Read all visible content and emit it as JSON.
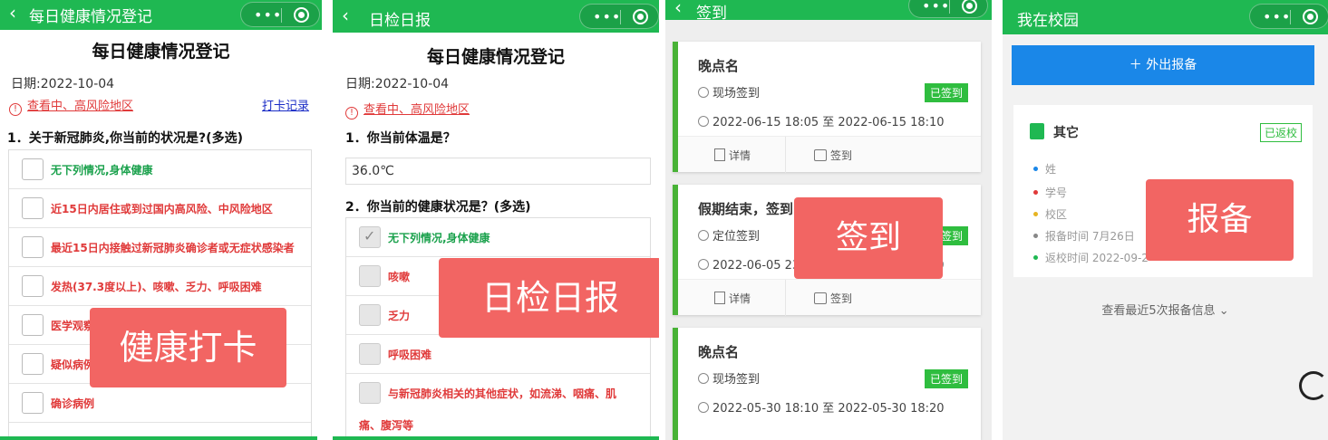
{
  "colors": {
    "nav_green": "#1fb852",
    "risk_red": "#e03a3a",
    "overlay_red": "#f26563",
    "blue_button": "#1a87e8",
    "signed_green": "#2fbd3f"
  },
  "panel1": {
    "nav_title": "每日健康情况登记",
    "form_title": "每日健康情况登记",
    "date": "日期:2022-10-04",
    "risk_link": "查看中、高风险地区",
    "record_link": "打卡记录",
    "question": "1．关于新冠肺炎,你当前的状况是?(多选)",
    "options": [
      "无下列情况,身体健康",
      "近15日内居住或到过国内高风险、中风险地区",
      "最近15日内接触过新冠肺炎确诊者或无症状感染者",
      "发热(37.3度以上)、咳嗽、乏力、呼吸困难",
      "医学观察",
      "疑似病例",
      "确诊病例"
    ],
    "overlay": "健康打卡"
  },
  "panel2": {
    "nav_title": "日检日报",
    "form_title": "每日健康情况登记",
    "date": "日期:2022-10-04",
    "risk_link": "查看中、高风险地区",
    "q1": "1．你当前体温是？",
    "temperature": "36.0℃",
    "q2": "2．你当前的健康状况是？(多选)",
    "options": [
      "无下列情况,身体健康",
      "咳嗽",
      "乏力",
      "呼吸困难",
      "与新冠肺炎相关的其他症状，如流涕、咽痛、肌",
      "痛、腹泻等"
    ],
    "overlay": "日检日报"
  },
  "panel3": {
    "nav_title": "签到",
    "cards": [
      {
        "title": "晚点名",
        "type": "现场签到",
        "status": "已签到",
        "time": "2022-06-15 18:05 至 2022-06-15 18:10",
        "detail": "详情",
        "sign": "签到"
      },
      {
        "title": "假期结束，签到",
        "type": "定位签到",
        "status": "已签到",
        "time": "2022-06-05 23:00 至 2022-06-05 23:30",
        "detail": "详情",
        "sign": "签到"
      },
      {
        "title": "晚点名",
        "type": "现场签到",
        "status": "已签到",
        "time": "2022-05-30 18:10 至 2022-05-30 18:20",
        "detail": "详情",
        "sign": "签到"
      }
    ],
    "overlay": "签到"
  },
  "panel4": {
    "nav_title": "我在校园",
    "out_button": "＋ 外出报备",
    "card_title": "其它",
    "returned": "已返校",
    "rows": [
      "姓",
      "学号",
      "校区",
      "报备时间 7月26日",
      "返校时间 2022-09-2"
    ],
    "more": "查看最近5次报备信息",
    "overlay": "报备"
  }
}
